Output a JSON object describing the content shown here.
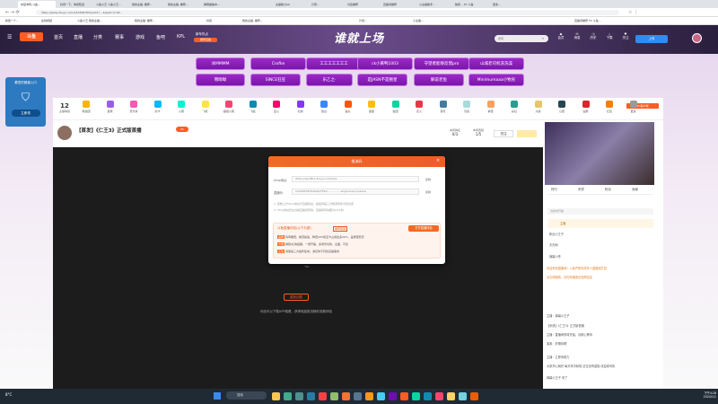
{
  "browser": {
    "tabs": [
      "夺冠冲刺-斗鱼...",
      "抖音一下，你就知道",
      "斗鱼小王 斗鱼小王...",
      "我的主播, 推荐...",
      "我的主播, 推荐...",
      "弹幕播放中...",
      "",
      "主播助力(0)",
      "计算...",
      "为您推荐",
      "直播间推荐",
      "小主播助手...",
      "独家... TC 斗鱼",
      "更多..."
    ],
    "url": "https://www.douyu.com/12345678?dyshid=...&dyshci=1#...",
    "bookmarks": [
      "新建一个...",
      "在线视频",
      "斗鱼小王 我的主播...",
      "我的主播, 推荐...",
      "抖音",
      "我的主播, 推荐...",
      "...",
      "",
      "计划...",
      "小主播...",
      "直播间推荐 TC 斗鱼..."
    ]
  },
  "site": {
    "logo": "斗鱼",
    "nav": [
      "首页",
      "直播",
      "分类",
      "赛事",
      "游戏",
      "鱼吧",
      "KPL"
    ],
    "nav_promo_title": "新年热点",
    "nav_promo_sub": "推荐直播",
    "banner_title": "谁就上场",
    "search_placeholder": "搜索",
    "header_icons": [
      "会员",
      "消息",
      "历史",
      "下载",
      "关注"
    ],
    "header_cta": "上传"
  },
  "pills": {
    "row1": [
      "冰MMMM",
      "Crofke",
      "工工工工工工工",
      "ck小黄鸭1003",
      "守望者能够反馈pro",
      "山城老司机洗洗澡"
    ],
    "row2": [
      "哦呦呦",
      "SINCE狂狂",
      "乐乙之·",
      "是JASN不是鲍星",
      "解说老鱼",
      "Minimumaaa小牧民"
    ]
  },
  "promo": {
    "title": "看您的频道入口",
    "button": "立即领"
  },
  "room": {
    "fans_count": "12",
    "fans_label": "主播等级",
    "title": "【首发】《仁王3》正式版首播",
    "tag": "TC",
    "stats": [
      {
        "label": "本周排名",
        "value": "0/3"
      },
      {
        "label": "本场贡献",
        "value": "1/5"
      },
      {
        "label": "",
        "value": "关注"
      }
    ],
    "gifts": [
      "粉丝团",
      "贵宾",
      "荧光棒",
      "办卡",
      "火箭",
      "飞机",
      "超级火箭",
      "飞船",
      "爱心",
      "礼物",
      "告白",
      "鱼丸",
      "星星",
      "饭团",
      "花火",
      "音符",
      "月亮",
      "紫薇",
      "彩虹",
      "大航",
      "心愿",
      "钻粉",
      "红包",
      "更多"
    ],
    "pc_client": "PC客户端",
    "bottom_button": "重新加载",
    "bottom_text": "你还可以下载APP观看，获得电脑般流畅的观看体验"
  },
  "modal": {
    "title": "推流码",
    "rtmp_label": "rtmp地址:",
    "rtmp_value": "rtmp://sendfb1.douyu.com/live",
    "key_label": "直播码:",
    "key_value": "12345678/f2dG0kjTFSm...............&dyscene=pc&live",
    "copy": "复制",
    "note1": "1. 复制上方rtmp地址与直播码后，粘贴到第三方推流软件对应位置",
    "note2": "2. rtmp地址仅在当前直播间有效，直播码有效期为24小时",
    "tools_title": "斗鱼直播伴侣(以下为原)",
    "tools_tag": "推荐使用",
    "tools_button": "打开直播伴侣",
    "features": [
      {
        "tag": "画质",
        "text": "码率翻倍，推流提速，降低CPU和显卡占用最多20%，画质更稳定"
      },
      {
        "tag": "方便",
        "text": "弹幕/礼物提醒，一键开播，多场景切换，全面，可靠"
      },
      {
        "tag": "互动",
        "text": "海量第三方插件集成，满足你不同的直播需求"
      }
    ]
  },
  "side": {
    "tabs": [
      "排行",
      "贵宾",
      "粉丝",
      "贡献"
    ],
    "subtabs": [
      "荣誉",
      "小贵宾",
      "小说排名",
      "更多"
    ],
    "promo": "当前未开播",
    "ranks": [
      "主播",
      "粉丝小王子",
      "天天刷",
      "弹幕小哥",
      "老粉"
    ],
    "chat": [
      "欢迎来到直播间！斗鱼严禁未成年人直播或打赏",
      "请文明观看，请勿传播违法违规信息",
      "主播：弹幕小王子",
      "【系统】《仁王3》正式版首播",
      "主播：直播间即将开始，请耐心等待",
      "某某：好期待啊",
      "主播：立即来助力",
      "大家开心就好 每天来中秋啦 这位也有激励 欢迎老司机",
      "弹幕小王子 来了"
    ]
  },
  "taskbar": {
    "search": "搜索",
    "weather": "8°C",
    "time": "下午4:28",
    "date": "2024/1/1"
  },
  "colors": {
    "accent": "#ff5d23",
    "purple": "#8e24aa",
    "modal_header": "#f26a22"
  }
}
